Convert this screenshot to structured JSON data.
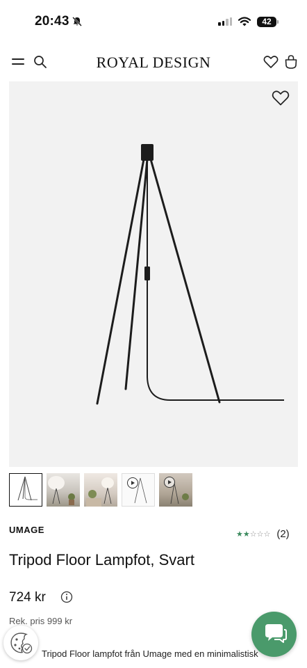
{
  "status_bar": {
    "time": "20:43",
    "battery": "42"
  },
  "header": {
    "brand": "ROYAL DESIGN"
  },
  "product": {
    "brand": "UMAGE",
    "rating": 2,
    "rating_max": 5,
    "review_count": "(2)",
    "title": "Tripod Floor Lampfot, Svart",
    "price": "724 kr",
    "rec_price": "Rek. pris 999 kr",
    "description": "Tripod Floor lampfot från Umage med en minimalistisk"
  },
  "thumbnails": [
    {
      "kind": "image",
      "selected": true
    },
    {
      "kind": "image",
      "selected": false
    },
    {
      "kind": "image",
      "selected": false
    },
    {
      "kind": "video",
      "selected": false
    },
    {
      "kind": "video",
      "selected": false
    }
  ],
  "icons": {
    "menu": "hamburger-menu-icon",
    "search": "search-icon",
    "wishlist": "heart-icon",
    "cart": "shopping-bag-icon",
    "cookie": "cookie-icon",
    "chat": "chat-icon",
    "info": "info-icon"
  },
  "colors": {
    "star_active": "#3c8a5e",
    "chat_button": "#4a9a6b",
    "image_background": "#f2f2f2"
  }
}
